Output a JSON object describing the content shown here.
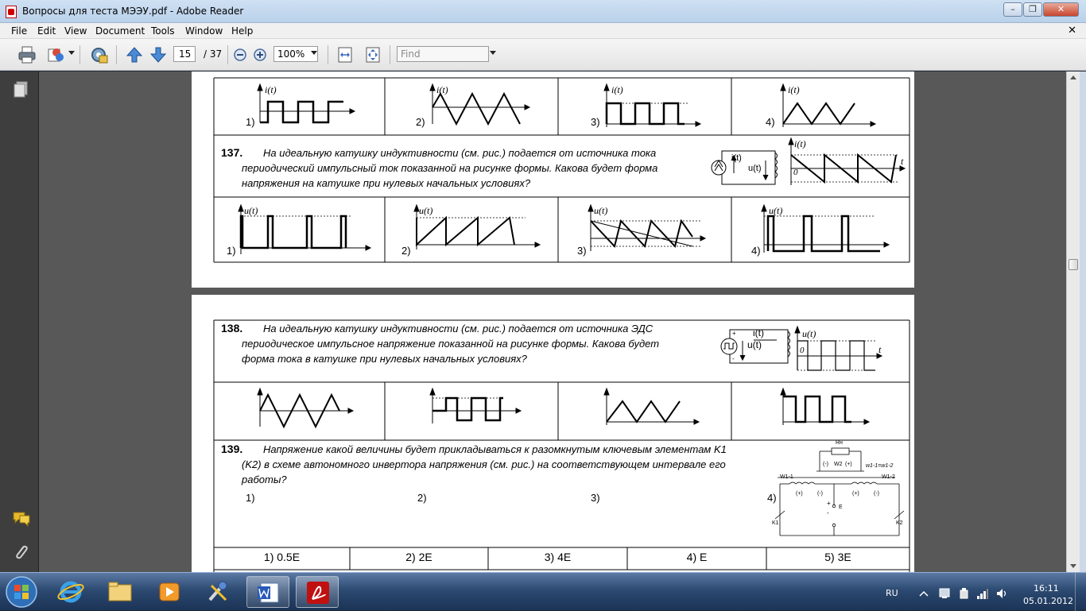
{
  "window": {
    "title": "Вопросы для теста МЭЭУ.pdf - Adobe Reader",
    "minimize": "–",
    "restore": "❐",
    "close": "✕"
  },
  "menu": {
    "items": [
      "File",
      "Edit",
      "View",
      "Document",
      "Tools",
      "Window",
      "Help"
    ],
    "close": "✕"
  },
  "toolbar": {
    "page_current": "15",
    "page_total": "/ 37",
    "zoom": "100%",
    "find_placeholder": "Find"
  },
  "doc": {
    "q136_options": [
      "1)",
      "2)",
      "3)",
      "4)"
    ],
    "q137": {
      "number": "137.",
      "lines": [
        "На идеальную катушку индуктивности (см. рис.) подается от источника тока",
        "периодический импульсный ток  показанной на рисунке формы. Какова будет форма",
        "напряжения на катушке при нулевых начальных условиях?"
      ],
      "options": [
        "1)",
        "2)",
        "3)",
        "4)"
      ]
    },
    "q138": {
      "number": "138.",
      "lines": [
        "На идеальную катушку индуктивности (см. рис.) подается от источника ЭДС",
        "периодическое импульсное напряжение показанной на рисунке формы. Какова будет",
        "форма тока в катушке при нулевых начальных условиях?"
      ],
      "options": [
        "1)",
        "2)",
        "3)",
        "4)"
      ]
    },
    "q139": {
      "number": "139.",
      "lines": [
        "Напряжение какой величины будет прикладываться к разомкнутым ключевым элементам K1",
        "(K2) в схеме автономного инвертора напряжения (см. рис.) на соответствующем интервале его",
        "работы?"
      ],
      "answers": [
        "1) 0.5E",
        "2) 2E",
        "3) 4E",
        "4) E",
        "5) 3E"
      ]
    },
    "labels": {
      "it": "i(t)",
      "ut": "u(t)",
      "t": "t",
      "zero": "0",
      "rh": "Rн",
      "w2": "W2",
      "w11": "W1-1",
      "w12": "W1-2",
      "weq": "w1-1=w1-2",
      "e": "E",
      "k1": "K1",
      "k2": "K2",
      "plus": "+",
      "minus": "-",
      "pp": "(+)",
      "pm": "(-)"
    }
  },
  "taskbar": {
    "lang": "RU",
    "time": "16:11",
    "date": "05.01.2012"
  },
  "colors": {
    "doc_background": "#585858",
    "taskbar": "#2d4a72",
    "titlebar": "#c6daf0"
  }
}
